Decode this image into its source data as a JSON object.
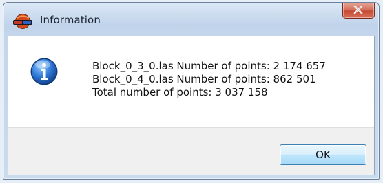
{
  "window": {
    "title": "Information",
    "close_label": "X",
    "icon": "app-3d-glasses-icon"
  },
  "dialog": {
    "icon": "info-icon",
    "lines": [
      "Block_0_3_0.las Number of points: 2 174 657",
      "Block_0_4_0.las Number of points: 862 501",
      "Total number of points: 3 037 158"
    ],
    "ok_label": "OK"
  },
  "colors": {
    "window_frame": "#c9daef",
    "close_button": "#c44a31",
    "info_icon": "#1f5fa8",
    "ok_button_border": "#3c7fb1"
  }
}
